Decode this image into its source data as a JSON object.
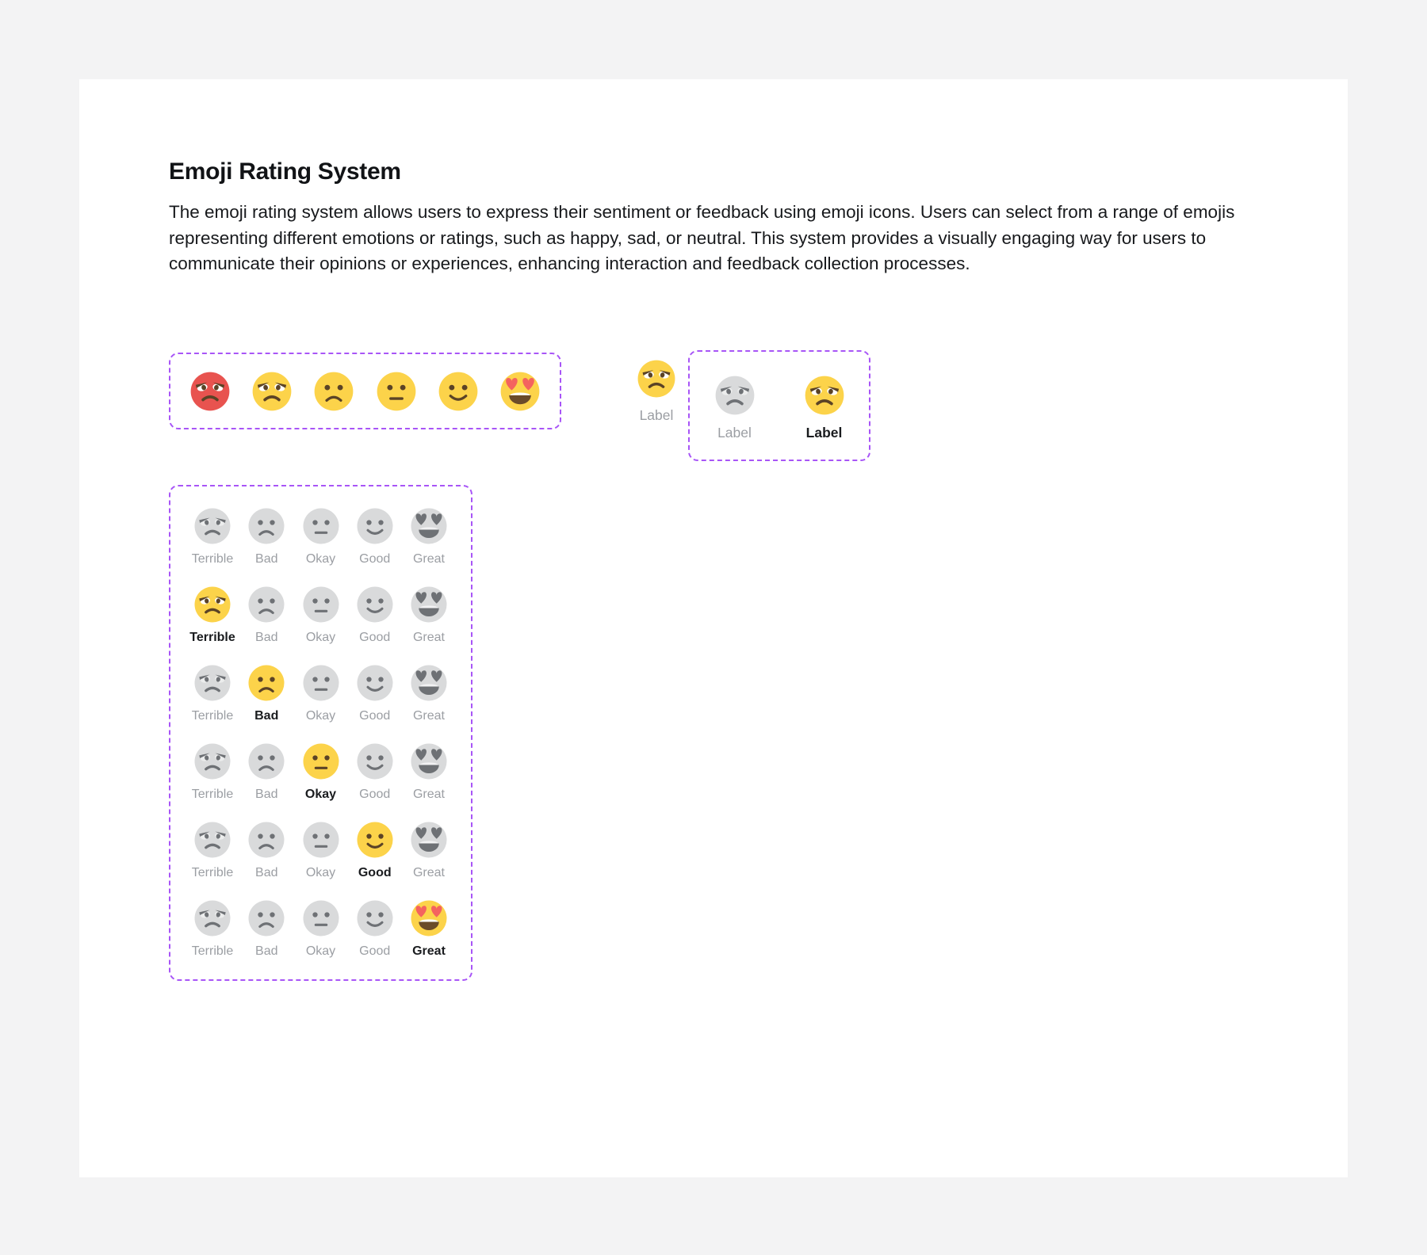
{
  "page": {
    "title": "Emoji Rating System",
    "description": "The emoji rating system allows users to express their sentiment or feedback using emoji icons. Users can select from a range of emojis representing different emotions or ratings, such as happy, sad, or neutral. This system provides a visually engaging way for users to communicate their opinions or experiences, enhancing interaction and feedback collection processes."
  },
  "colors": {
    "page_background": "#f3f3f4",
    "card_background": "#ffffff",
    "dashed_outline": "#a855f7",
    "emoji_active_yellow": "#fcd34a",
    "emoji_rage_red": "#e8534f",
    "emoji_inactive_gray": "#d9dadb",
    "feature_gray": "#6e7175",
    "heart_red": "#f4635f",
    "label_inactive": "#9b9ea3",
    "label_active": "#1a1c1f"
  },
  "palette": {
    "name": "emoji-palette",
    "emojis": [
      {
        "name": "rage",
        "variant": "rage"
      },
      {
        "name": "angry",
        "variant": "angry"
      },
      {
        "name": "frown",
        "variant": "frown"
      },
      {
        "name": "neutral",
        "variant": "neutral"
      },
      {
        "name": "smile",
        "variant": "smile"
      },
      {
        "name": "heart-eyes",
        "variant": "heart-eyes"
      }
    ]
  },
  "single_sample": {
    "emoji": "angry",
    "label": "Label",
    "selected": false
  },
  "pair_sample": {
    "items": [
      {
        "emoji": "angry",
        "label": "Label",
        "selected": false
      },
      {
        "emoji": "angry",
        "label": "Label",
        "selected": true
      }
    ]
  },
  "rating_scale": {
    "options": [
      {
        "key": "terrible",
        "label": "Terrible",
        "emoji": "angry"
      },
      {
        "key": "bad",
        "label": "Bad",
        "emoji": "frown"
      },
      {
        "key": "okay",
        "label": "Okay",
        "emoji": "neutral"
      },
      {
        "key": "good",
        "label": "Good",
        "emoji": "smile"
      },
      {
        "key": "great",
        "label": "Great",
        "emoji": "heart-eyes"
      }
    ],
    "rows": [
      {
        "selected": null
      },
      {
        "selected": "terrible"
      },
      {
        "selected": "bad"
      },
      {
        "selected": "okay"
      },
      {
        "selected": "good"
      },
      {
        "selected": "great"
      }
    ]
  }
}
